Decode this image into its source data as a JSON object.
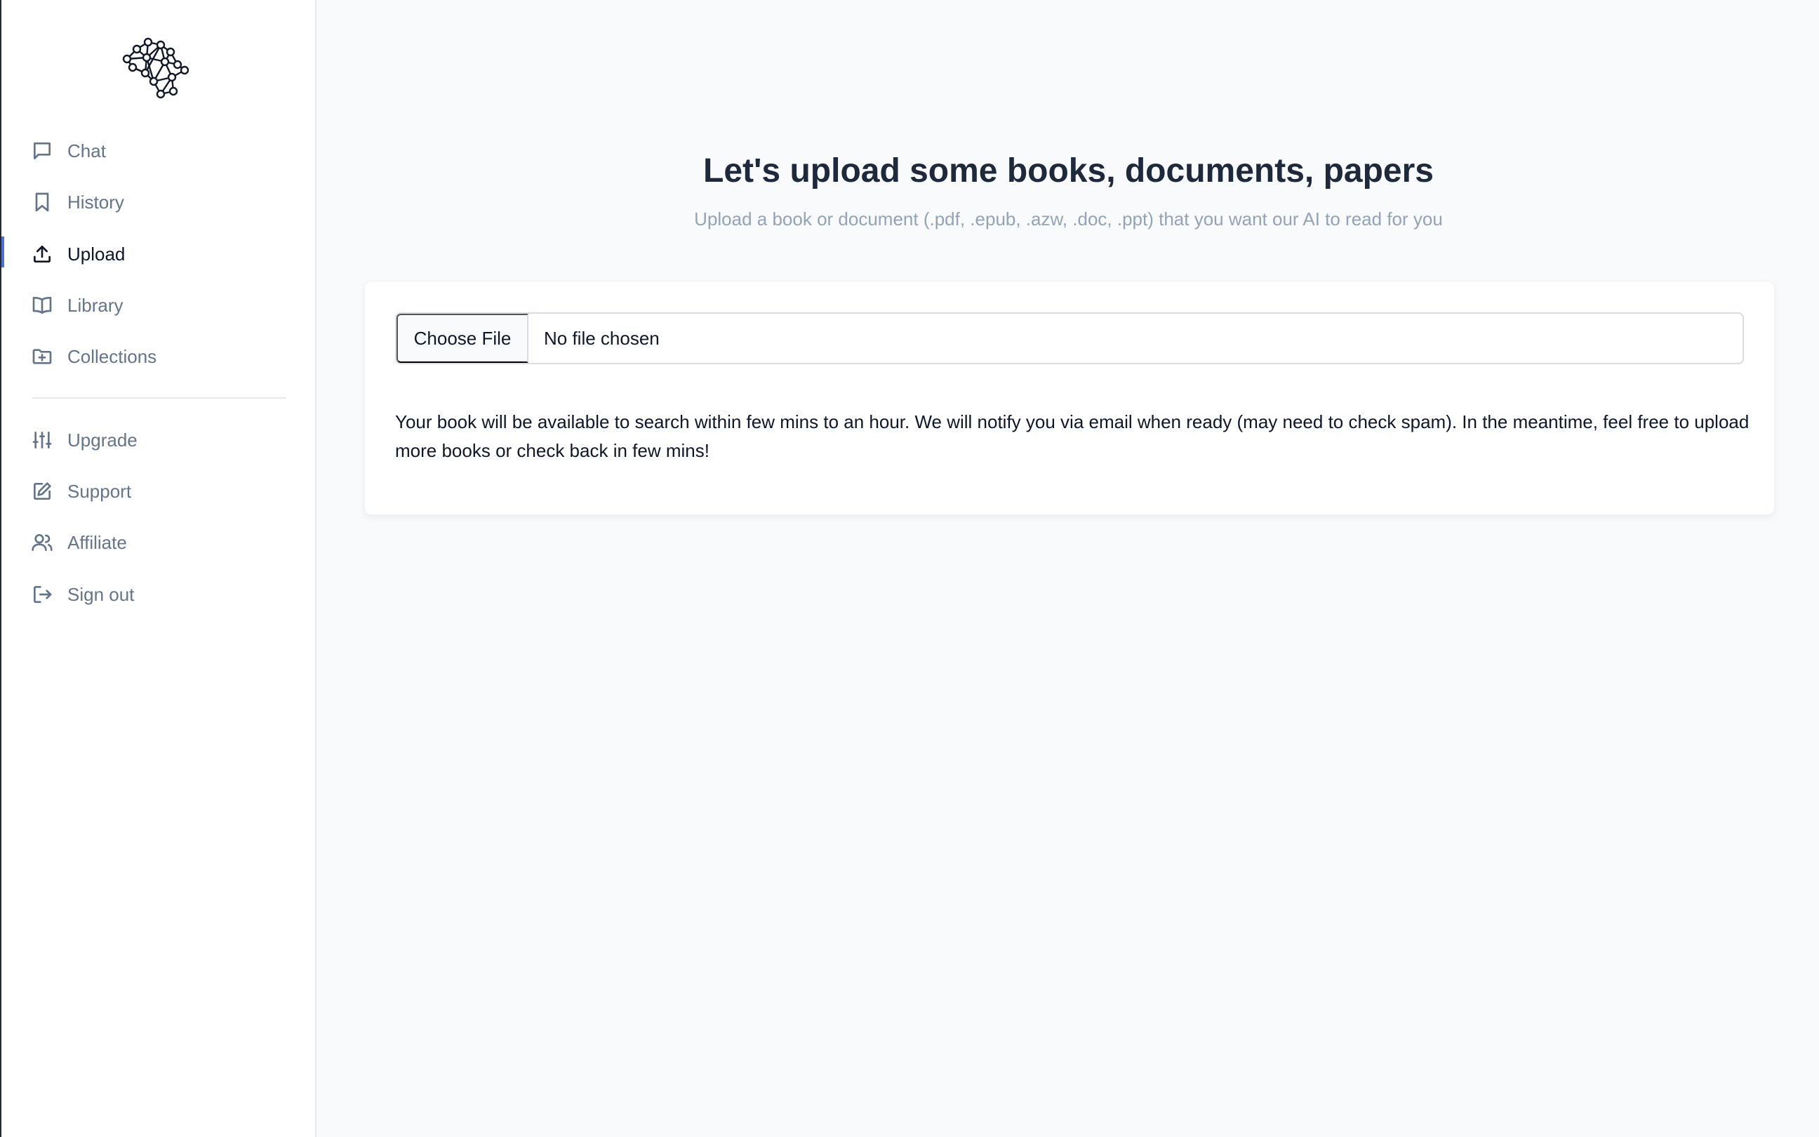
{
  "sidebar": {
    "logo_icon": "neural-network-brain-icon",
    "items": [
      {
        "label": "Chat",
        "icon": "chat-bubble-icon"
      },
      {
        "label": "History",
        "icon": "bookmark-icon"
      },
      {
        "label": "Upload",
        "icon": "upload-icon",
        "active": true
      },
      {
        "label": "Library",
        "icon": "open-book-icon"
      },
      {
        "label": "Collections",
        "icon": "folder-plus-icon"
      }
    ],
    "secondary_items": [
      {
        "label": "Upgrade",
        "icon": "sliders-icon"
      },
      {
        "label": "Support",
        "icon": "edit-icon"
      },
      {
        "label": "Affiliate",
        "icon": "users-icon"
      },
      {
        "label": "Sign out",
        "icon": "sign-out-icon"
      }
    ]
  },
  "main": {
    "title": "Let's upload some books, documents, papers",
    "subtitle": "Upload a book or document (.pdf, .epub, .azw, .doc, .ppt) that you want our AI to read for you",
    "file_input": {
      "button_label": "Choose File",
      "status": "No file chosen"
    },
    "note": "Your book will be available to search within few mins to an hour. We will notify you via email when ready (may need to check spam). In the meantime, feel free to upload more books or check back in few mins!"
  },
  "colors": {
    "accent": "#4f6ed6",
    "muted_text": "#64748b",
    "title_text": "#1e293b",
    "background": "#f8fafc"
  }
}
